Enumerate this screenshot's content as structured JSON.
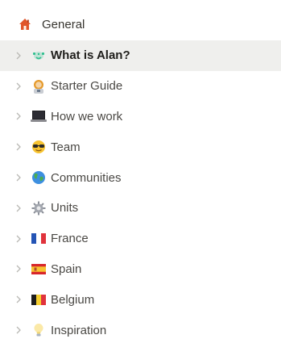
{
  "section": {
    "title": "General",
    "icon": "house-icon"
  },
  "items": [
    {
      "label": "What is Alan?",
      "icon": "alien-face-icon",
      "selected": true
    },
    {
      "label": "Starter Guide",
      "icon": "astronaut-icon",
      "selected": false
    },
    {
      "label": "How we work",
      "icon": "laptop-icon",
      "selected": false
    },
    {
      "label": "Team",
      "icon": "sunglasses-face-icon",
      "selected": false
    },
    {
      "label": "Communities",
      "icon": "globe-icon",
      "selected": false
    },
    {
      "label": "Units",
      "icon": "gear-icon",
      "selected": false
    },
    {
      "label": "France",
      "icon": "france-flag-icon",
      "selected": false
    },
    {
      "label": "Spain",
      "icon": "spain-flag-icon",
      "selected": false
    },
    {
      "label": "Belgium",
      "icon": "belgium-flag-icon",
      "selected": false
    },
    {
      "label": "Inspiration",
      "icon": "light-bulb-icon",
      "selected": false
    }
  ],
  "colors": {
    "selected_bg": "#efefed",
    "text": "#4a4844",
    "house": "#e0562b"
  }
}
